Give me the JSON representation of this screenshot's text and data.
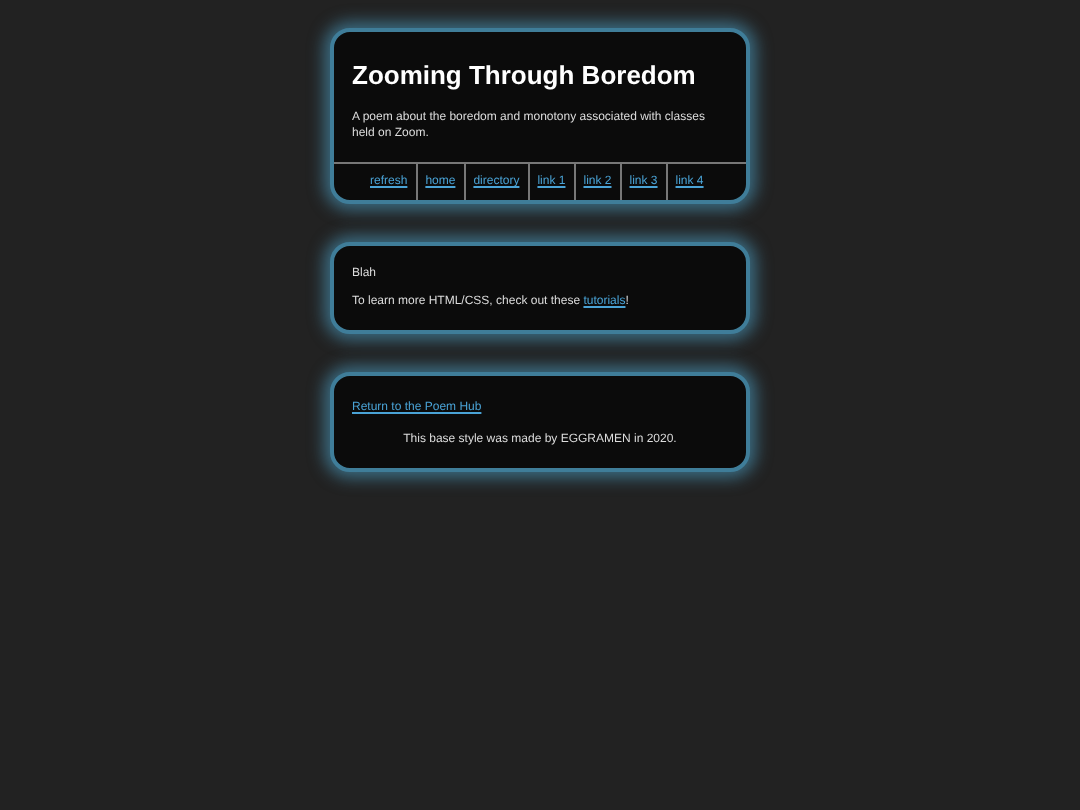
{
  "header": {
    "title": "Zooming Through Boredom",
    "subtitle": "A poem about the boredom and monotony associated with classes held on Zoom."
  },
  "nav": [
    "refresh",
    "home",
    "directory",
    "link 1",
    "link 2",
    "link 3",
    "link 4"
  ],
  "content": {
    "text": "Blah",
    "learn": {
      "before": "To learn more HTML/CSS, check out these ",
      "link": "tutorials",
      "after": "!"
    }
  },
  "footer": {
    "link": "Return to the Poem Hub",
    "credit": "This base style was made by EGGRAMEN in 2020."
  }
}
